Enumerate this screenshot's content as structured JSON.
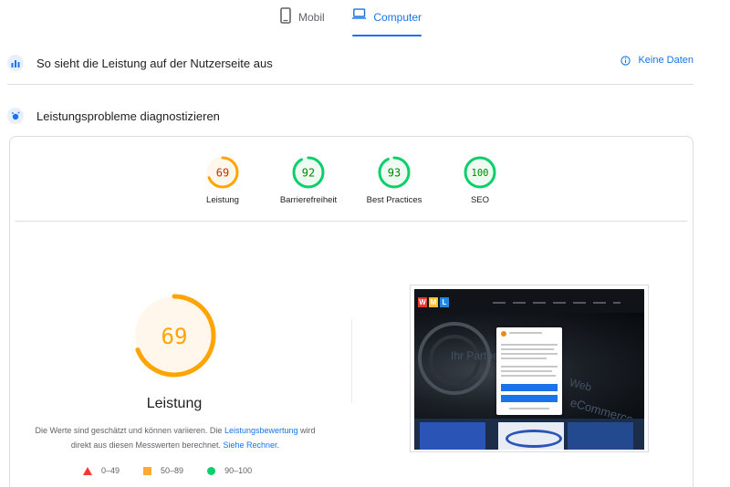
{
  "tabs": {
    "mobile_label": "Mobil",
    "desktop_label": "Computer",
    "active": "desktop"
  },
  "field_data": {
    "title": "So sieht die Leistung auf der Nutzerseite aus",
    "no_data_label": "Keine Daten"
  },
  "diagnostics": {
    "title": "Leistungsprobleme diagnostizieren"
  },
  "scores": [
    {
      "label": "Leistung",
      "value": "69",
      "color": "#ffa400",
      "bg": "#fff7ec"
    },
    {
      "label": "Barrierefreiheit",
      "value": "92",
      "color": "#0cce6b",
      "bg": "#eefbf3"
    },
    {
      "label": "Best Practices",
      "value": "93",
      "color": "#0cce6b",
      "bg": "#eefbf3"
    },
    {
      "label": "SEO",
      "value": "100",
      "color": "#0cce6b",
      "bg": "#eefbf3"
    }
  ],
  "main_score": {
    "value": "69",
    "label": "Leistung",
    "color": "#ffa400"
  },
  "description": {
    "part1": "Die Werte sind geschätzt und können variieren. Die ",
    "link1": "Leistungsbewertung",
    "part2": " wird direkt aus diesen Messwerten berechnet. ",
    "link2": "Siehe Rechner."
  },
  "legend": [
    {
      "range": "0–49",
      "color": "#ff3333"
    },
    {
      "range": "50–89",
      "color": "#ffaa33"
    },
    {
      "range": "90–100",
      "color": "#0cce6b"
    }
  ],
  "screenshot": {
    "logo_letters": [
      "W",
      "M",
      "L"
    ],
    "hero_texts": [
      "Ihr Partner",
      "Web",
      "eCommerce"
    ]
  }
}
